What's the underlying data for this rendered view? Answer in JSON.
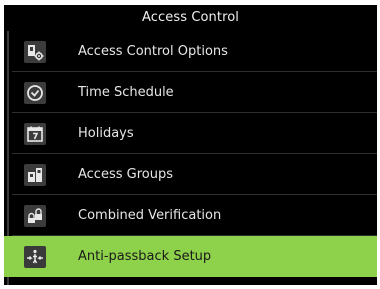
{
  "header": {
    "title": "Access Control"
  },
  "menu": {
    "items": [
      {
        "label": "Access Control Options",
        "icon": "access-options-icon"
      },
      {
        "label": "Time Schedule",
        "icon": "clock-icon"
      },
      {
        "label": "Holidays",
        "icon": "calendar-icon"
      },
      {
        "label": "Access Groups",
        "icon": "access-groups-icon"
      },
      {
        "label": "Combined Verification",
        "icon": "lock-icon"
      },
      {
        "label": "Anti-passback Setup",
        "icon": "anti-passback-icon"
      }
    ],
    "selected_index": 5
  },
  "colors": {
    "background": "#000000",
    "selected": "#8ed14a",
    "text": "#e6e6e6",
    "icon_background": "#3c3c3c"
  }
}
